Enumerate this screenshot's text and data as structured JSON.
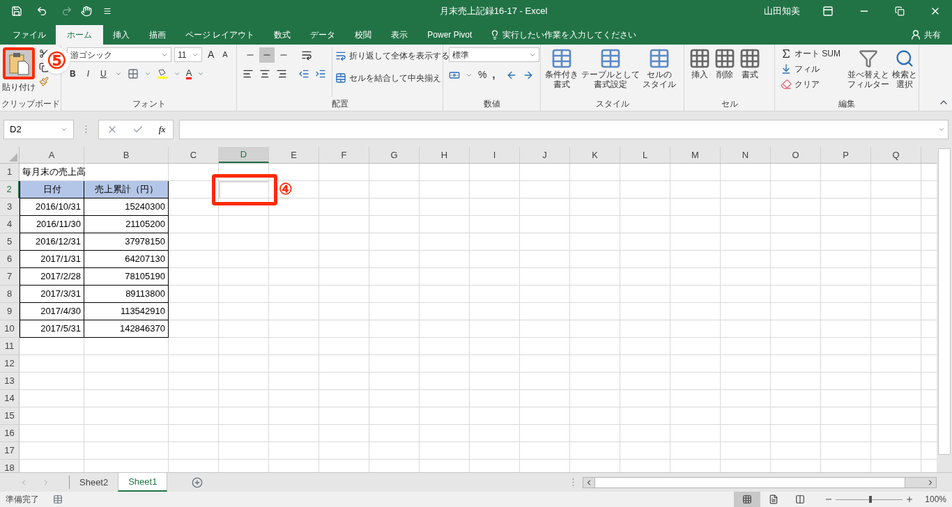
{
  "title_bar": {
    "title": "月末売上記録16-17  -  Excel",
    "user": "山田知美"
  },
  "tabs": [
    {
      "label": "ファイル",
      "selected": false
    },
    {
      "label": "ホーム",
      "selected": true
    },
    {
      "label": "挿入",
      "selected": false
    },
    {
      "label": "描画",
      "selected": false
    },
    {
      "label": "ページ レイアウト",
      "selected": false
    },
    {
      "label": "数式",
      "selected": false
    },
    {
      "label": "データ",
      "selected": false
    },
    {
      "label": "校閲",
      "selected": false
    },
    {
      "label": "表示",
      "selected": false
    },
    {
      "label": "Power Pivot",
      "selected": false
    }
  ],
  "tell_me": "実行したい作業を入力してください",
  "share": "共有",
  "ribbon": {
    "clipboard": {
      "paste": "貼り付け",
      "label": "クリップボード"
    },
    "font": {
      "name": "游ゴシック",
      "size": "11",
      "grow": "A",
      "shrink": "A",
      "style_buttons": [
        "B",
        "I",
        "U"
      ],
      "font_color": "A",
      "label": "フォント"
    },
    "alignment": {
      "vertical": [
        {
          "selected": false
        },
        {
          "selected": true
        },
        {
          "selected": false
        }
      ],
      "wrap": "折り返して全体を表示する",
      "merge": "セルを結合して中央揃え",
      "label": "配置"
    },
    "number": {
      "format": "標準",
      "percent": "%",
      "comma": ",",
      "label": "数値"
    },
    "styles": {
      "buttons": [
        [
          "条件付き",
          "書式"
        ],
        [
          "テーブルとして",
          "書式設定"
        ],
        [
          "セルの",
          "スタイル"
        ]
      ],
      "label": "スタイル"
    },
    "cells": {
      "buttons": [
        "挿入",
        "削除",
        "書式"
      ],
      "label": "セル"
    },
    "editing": {
      "autosum": "オート SUM",
      "fill": "フィル",
      "clear": "クリア",
      "sort": [
        "並べ替えと",
        "フィルター"
      ],
      "find": [
        "検索と",
        "選択"
      ],
      "label": "編集"
    }
  },
  "formula_bar": {
    "name_box": "D2",
    "fx": "fx"
  },
  "sheet": {
    "columns": [
      {
        "label": "A",
        "selected": false
      },
      {
        "label": "B",
        "selected": false
      },
      {
        "label": "C",
        "selected": false
      },
      {
        "label": "D",
        "selected": true
      },
      {
        "label": "E",
        "selected": false
      },
      {
        "label": "F",
        "selected": false
      },
      {
        "label": "G",
        "selected": false
      },
      {
        "label": "H",
        "selected": false
      },
      {
        "label": "I",
        "selected": false
      },
      {
        "label": "J",
        "selected": false
      },
      {
        "label": "K",
        "selected": false
      },
      {
        "label": "L",
        "selected": false
      },
      {
        "label": "M",
        "selected": false
      },
      {
        "label": "N",
        "selected": false
      },
      {
        "label": "O",
        "selected": false
      },
      {
        "label": "P",
        "selected": false
      },
      {
        "label": "Q",
        "selected": false
      }
    ],
    "rows": [
      {
        "number": "1",
        "selected": false,
        "kind": "title",
        "cells": [
          "毎月末の売上高"
        ]
      },
      {
        "number": "2",
        "selected": true,
        "kind": "header",
        "cells": [
          "日付",
          "売上累計（円）"
        ]
      },
      {
        "number": "3",
        "selected": false,
        "kind": "data",
        "cells": [
          "2016/10/31",
          "15240300"
        ]
      },
      {
        "number": "4",
        "selected": false,
        "kind": "data",
        "cells": [
          "2016/11/30",
          "21105200"
        ]
      },
      {
        "number": "5",
        "selected": false,
        "kind": "data",
        "cells": [
          "2016/12/31",
          "37978150"
        ]
      },
      {
        "number": "6",
        "selected": false,
        "kind": "data",
        "cells": [
          "2017/1/31",
          "64207130"
        ]
      },
      {
        "number": "7",
        "selected": false,
        "kind": "data",
        "cells": [
          "2017/2/28",
          "78105190"
        ]
      },
      {
        "number": "8",
        "selected": false,
        "kind": "data",
        "cells": [
          "2017/3/31",
          "89113800"
        ]
      },
      {
        "number": "9",
        "selected": false,
        "kind": "data",
        "cells": [
          "2017/4/30",
          "113542910"
        ]
      },
      {
        "number": "10",
        "selected": false,
        "kind": "data",
        "cells": [
          "2017/5/31",
          "142846370"
        ]
      },
      {
        "number": "11",
        "selected": false
      },
      {
        "number": "12",
        "selected": false
      },
      {
        "number": "13",
        "selected": false
      },
      {
        "number": "14",
        "selected": false
      },
      {
        "number": "15",
        "selected": false
      },
      {
        "number": "16",
        "selected": false
      },
      {
        "number": "17",
        "selected": false
      },
      {
        "number": "18",
        "selected": false
      }
    ]
  },
  "annotations": [
    {
      "label": "⑤"
    },
    {
      "label": "④"
    }
  ],
  "sheet_tabs": [
    {
      "name": "Sheet2",
      "selected": false
    },
    {
      "name": "Sheet1",
      "selected": true
    }
  ],
  "status_bar": {
    "status": "準備完了",
    "views": [
      {
        "selected": true
      },
      {
        "selected": false
      },
      {
        "selected": false
      }
    ],
    "zoom": {
      "level": 0.52
    },
    "zoom_text": "100%"
  }
}
